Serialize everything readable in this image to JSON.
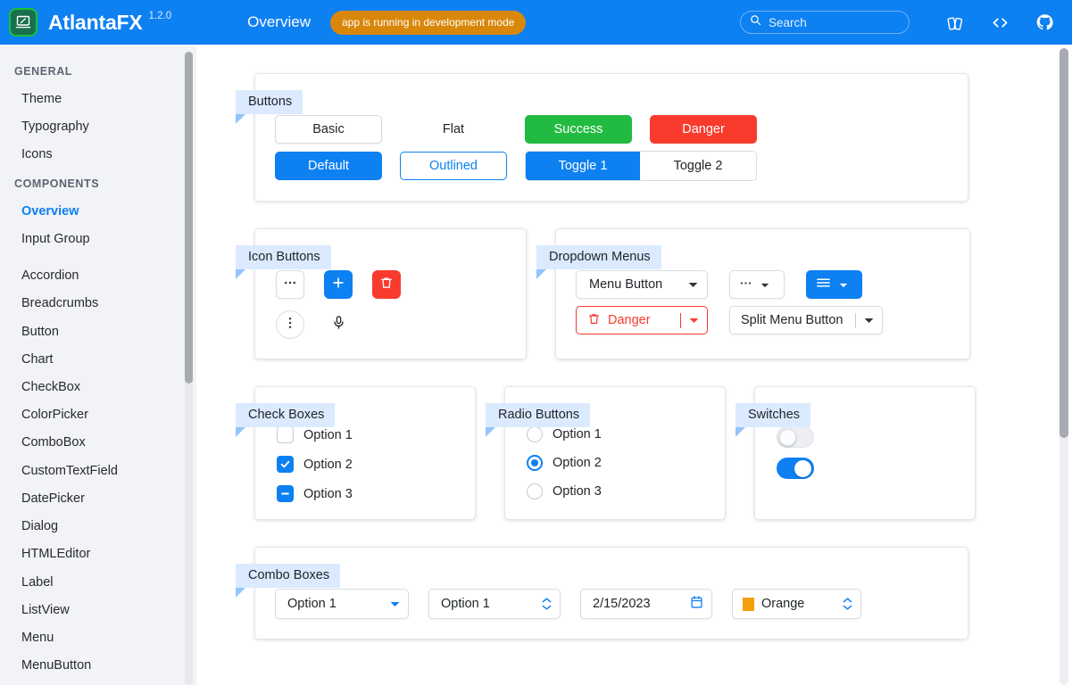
{
  "header": {
    "brand": "AtlantaFX",
    "version": "1.2.0",
    "nav_title": "Overview",
    "dev_badge": "app is running in development mode",
    "search_placeholder": "Search",
    "search_value": "",
    "icons": [
      "search-icon",
      "theme-icon",
      "source-code-icon",
      "github-icon"
    ],
    "accent": "#0d80f2",
    "badge_color": "#d9870b"
  },
  "sidebar": {
    "sections": [
      {
        "title": "GENERAL",
        "items": [
          {
            "label": "Theme",
            "active": false
          },
          {
            "label": "Typography",
            "active": false
          },
          {
            "label": "Icons",
            "active": false
          }
        ]
      },
      {
        "title": "COMPONENTS",
        "items": [
          {
            "label": "Overview",
            "active": true
          },
          {
            "label": "Input Group",
            "active": false
          },
          {
            "label": "Accordion",
            "active": false
          },
          {
            "label": "Breadcrumbs",
            "active": false
          },
          {
            "label": "Button",
            "active": false
          },
          {
            "label": "Chart",
            "active": false
          },
          {
            "label": "CheckBox",
            "active": false
          },
          {
            "label": "ColorPicker",
            "active": false
          },
          {
            "label": "ComboBox",
            "active": false
          },
          {
            "label": "CustomTextField",
            "active": false
          },
          {
            "label": "DatePicker",
            "active": false
          },
          {
            "label": "Dialog",
            "active": false
          },
          {
            "label": "HTMLEditor",
            "active": false
          },
          {
            "label": "Label",
            "active": false
          },
          {
            "label": "ListView",
            "active": false
          },
          {
            "label": "Menu",
            "active": false
          },
          {
            "label": "MenuButton",
            "active": false
          }
        ]
      }
    ]
  },
  "cards": {
    "buttons": {
      "title": "Buttons",
      "row1": [
        {
          "label": "Basic",
          "style": "basic"
        },
        {
          "label": "Flat",
          "style": "flat"
        },
        {
          "label": "Success",
          "style": "success"
        },
        {
          "label": "Danger",
          "style": "danger"
        }
      ],
      "row2": [
        {
          "label": "Default",
          "style": "default"
        },
        {
          "label": "Outlined",
          "style": "outlined"
        }
      ],
      "toggles": [
        {
          "label": "Toggle 1",
          "selected": true
        },
        {
          "label": "Toggle 2",
          "selected": false
        }
      ]
    },
    "icon_buttons": {
      "title": "Icon Buttons",
      "row1": [
        {
          "icon": "more-horizontal-icon",
          "style": "outline"
        },
        {
          "icon": "plus-icon",
          "style": "blue"
        },
        {
          "icon": "trash-icon",
          "style": "red"
        }
      ],
      "row2": [
        {
          "icon": "more-vertical-icon",
          "style": "circle"
        },
        {
          "icon": "microphone-icon",
          "style": "flat"
        }
      ]
    },
    "dropdown_menus": {
      "title": "Dropdown Menus",
      "row1": [
        {
          "label": "Menu Button",
          "style": "default",
          "icon": null
        },
        {
          "label": "",
          "style": "default",
          "icon": "more-horizontal-icon"
        },
        {
          "label": "",
          "style": "blue",
          "icon": "hamburger-icon"
        }
      ],
      "row2": [
        {
          "label": "Danger",
          "style": "danger",
          "icon": "trash-icon",
          "split": true
        },
        {
          "label": "Split Menu Button",
          "style": "default",
          "icon": null,
          "split": true
        }
      ]
    },
    "check_boxes": {
      "title": "Check Boxes",
      "options": [
        {
          "label": "Option 1",
          "state": "unchecked"
        },
        {
          "label": "Option 2",
          "state": "checked"
        },
        {
          "label": "Option 3",
          "state": "indeterminate"
        }
      ]
    },
    "radio_buttons": {
      "title": "Radio Buttons",
      "options": [
        {
          "label": "Option 1",
          "selected": false
        },
        {
          "label": "Option 2",
          "selected": true
        },
        {
          "label": "Option 3",
          "selected": false
        }
      ]
    },
    "switches": {
      "title": "Switches",
      "items": [
        {
          "state": "off"
        },
        {
          "state": "on"
        }
      ]
    },
    "combo_boxes": {
      "title": "Combo Boxes",
      "items": [
        {
          "value": "Option 1",
          "kind": "combobox",
          "icon": "chevron-down-icon"
        },
        {
          "value": "Option 1",
          "kind": "spinner",
          "icon": "spinner-arrows-icon"
        },
        {
          "value": "2/15/2023",
          "kind": "datepicker",
          "icon": "calendar-icon"
        },
        {
          "value": "Orange",
          "kind": "colorpicker",
          "icon": "spinner-arrows-icon",
          "swatch": "#f59e0b"
        }
      ]
    }
  }
}
